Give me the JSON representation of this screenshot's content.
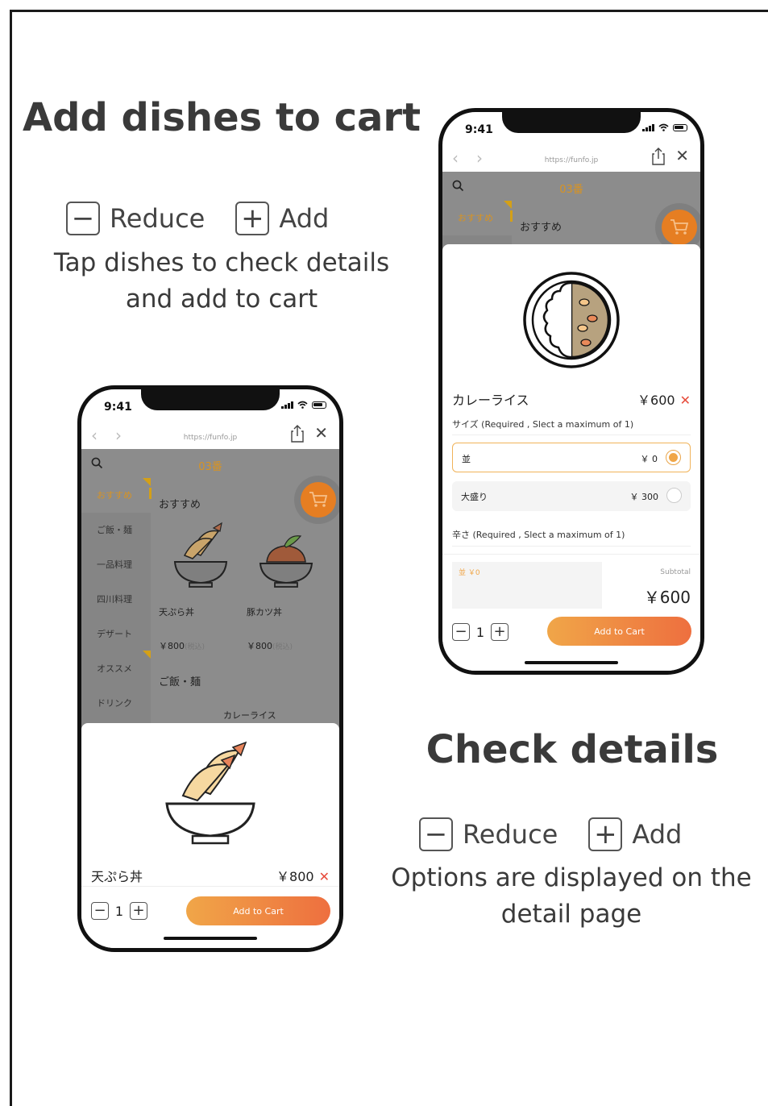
{
  "left_panel": {
    "heading": "Add dishes to cart",
    "legend": {
      "reduce_symbol": "−",
      "reduce_label": "Reduce",
      "add_symbol": "+",
      "add_label": "Add"
    },
    "desc_line1": "Tap dishes to check details",
    "desc_line2": "and add to cart"
  },
  "right_panel": {
    "heading": "Check details",
    "legend": {
      "reduce_symbol": "−",
      "reduce_label": "Reduce",
      "add_symbol": "+",
      "add_label": "Add"
    },
    "desc_line1": "Options are displayed on the",
    "desc_line2": "detail page"
  },
  "phone_common": {
    "time": "9:41",
    "url": "https://funfo.jp",
    "table_no": "03番",
    "back_icon": "‹",
    "forward_icon": "›",
    "close_icon": "✕"
  },
  "phone_left": {
    "sidebar": [
      "おすすめ",
      "ご飯・麺",
      "一品料理",
      "四川料理",
      "デザート",
      "オススメ",
      "ドリンク"
    ],
    "section_title": "おすすめ",
    "section2_title": "ご飯・麺",
    "dishes": [
      {
        "name": "天ぷら丼",
        "price": "￥800",
        "tax": "(税込)"
      },
      {
        "name": "豚カツ丼",
        "price": "￥800",
        "tax": "(税込)"
      }
    ],
    "partial_dish_name": "カレーライス",
    "detail": {
      "name": "天ぷら丼",
      "price": "￥800",
      "quantity": "1",
      "add_to_cart": "Add to Cart"
    }
  },
  "phone_right": {
    "sidebar_active": "おすすめ",
    "section_title": "おすすめ",
    "detail": {
      "name": "カレーライス",
      "price": "￥600",
      "group1_title": "サイズ (Required , Slect a maximum of 1)",
      "options": [
        {
          "name": "並",
          "price": "￥ 0",
          "selected": true
        },
        {
          "name": "大盛り",
          "price": "￥ 300",
          "selected": false
        }
      ],
      "group2_title": "辛さ (Required , Slect a maximum of 1)",
      "note": "並 ￥0",
      "subtotal_label": "Subtotal",
      "subtotal": "￥600",
      "quantity": "1",
      "add_to_cart": "Add to Cart"
    }
  },
  "colors": {
    "accent": "#f0a648",
    "accent_dark": "#ee6f3f",
    "close_red": "#e74c3c",
    "overlay": "#8c8c8c"
  }
}
